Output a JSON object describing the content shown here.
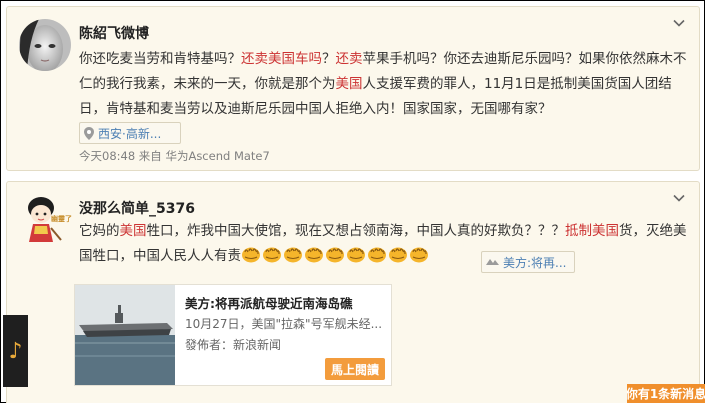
{
  "post1": {
    "username": "陈紹飞微博",
    "text_segments": [
      {
        "t": "你还吃麦当劳和肯特基吗？",
        "hl": false
      },
      {
        "t": "还卖美国车吗",
        "hl": true
      },
      {
        "t": "？",
        "hl": false
      },
      {
        "t": "还卖",
        "hl": true
      },
      {
        "t": "苹果手机吗？你还去迪斯尼乐园吗？如果你依然麻木不仁的我行我素，未来的一天，你就是那个为",
        "hl": false
      },
      {
        "t": "美国",
        "hl": true
      },
      {
        "t": "人支援军费的罪人，11月1日是抵制美国货国人团结日，肯特基和麦当劳以及迪斯尼乐园中国人拒绝入内！国家国家，无国哪有家？",
        "hl": false
      }
    ],
    "location_tag": "西安·高新...",
    "meta": "今天08:48 来自 华为Ascend Mate7"
  },
  "post2": {
    "username": "没那么简单_5376",
    "avatar_caption": "幽靈了",
    "text_segments": [
      {
        "t": "它妈的",
        "hl": false
      },
      {
        "t": "美国",
        "hl": true
      },
      {
        "t": "牲口，炸我中国大使馆，现在又想占领南海，中国人真的好欺负？？？",
        "hl": false
      },
      {
        "t": "抵制美国",
        "hl": true
      },
      {
        "t": "货，灭绝美国牲口，中国人民人人有责",
        "hl": false
      }
    ],
    "emoji_count": 9,
    "link_tag": "美方:将再...",
    "share": {
      "title": "美方:将再派航母驶近南海岛礁",
      "desc": "10月27日，美国\"拉森\"号军舰未经...",
      "source": "發佈者：新浪新闻",
      "button": "馬上閱讀"
    }
  },
  "music_icon": "♪",
  "corner_button": "你有1条新消息"
}
